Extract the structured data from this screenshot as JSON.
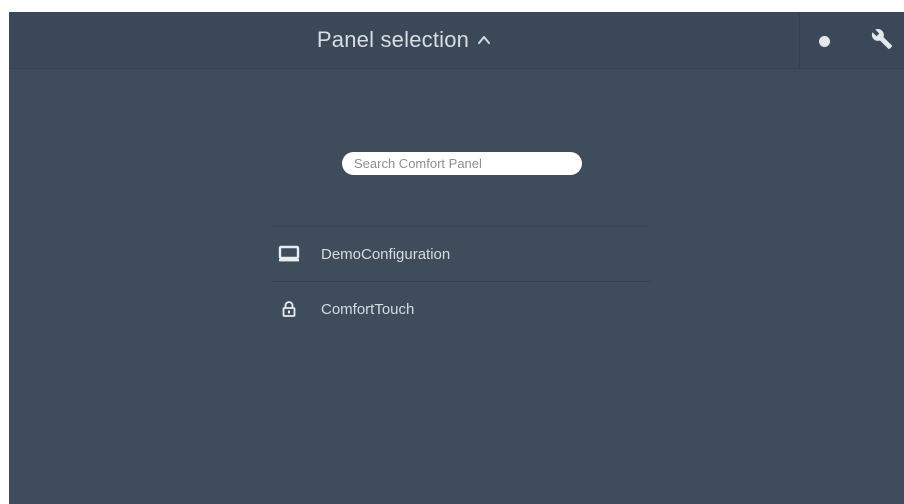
{
  "header": {
    "title": "Panel selection",
    "toggle_icon": "caret-up-icon",
    "status_icon": "status-dot-icon",
    "settings_icon": "wrench-icon"
  },
  "search": {
    "placeholder": "Search Comfort Panel",
    "value": ""
  },
  "panels": [
    {
      "label": "DemoConfiguration",
      "icon": "monitor-icon"
    },
    {
      "label": "ComfortTouch",
      "icon": "lock-icon"
    }
  ],
  "colors": {
    "background": "#3e4c5b",
    "topbar": "#3a4857",
    "text": "#d6dbe0"
  }
}
